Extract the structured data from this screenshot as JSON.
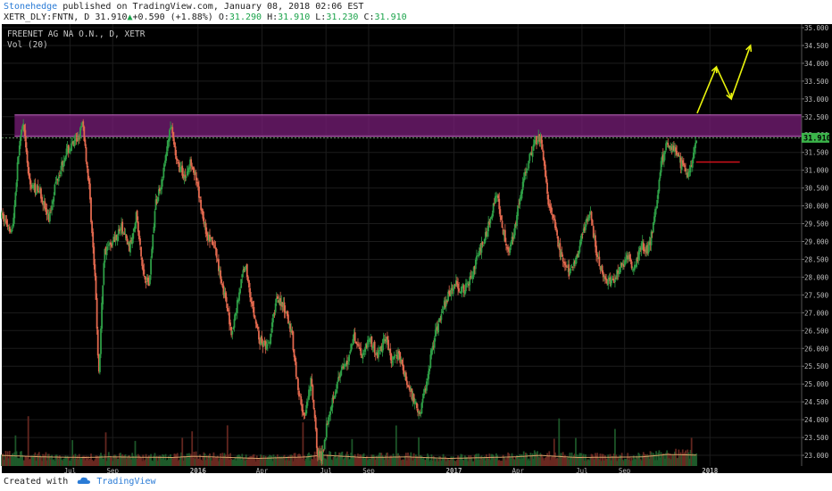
{
  "header": {
    "author": "Stonehedge",
    "published": "published on TradingView.com, January 08, 2018 02:06 EST",
    "symbol": "XETR_DLY:FNTN, D",
    "last": "31.910",
    "up_arrow": "▲",
    "change": "+0.590 (+1.88%)",
    "o_label": "O:",
    "o_val": "31.290",
    "h_label": "H:",
    "h_val": "31.910",
    "l_label": "L:",
    "l_val": "31.230",
    "c_label": "C:",
    "c_val": "31.910"
  },
  "footer": {
    "created_with": "Created with",
    "tv_icon": "cloud-logo-icon",
    "brand": "TradingView"
  },
  "colors": {
    "background": "#000000",
    "grid": "#1c1c1c",
    "up": "#2e9e46",
    "down": "#e1684e",
    "zone": "#7d1f7d",
    "zone_border": "#c66ac6",
    "annotation": "#e8f20d",
    "support": "#d1111b",
    "last_price_label": "#3bb54a",
    "vol_ma": "#d9a36a"
  },
  "chart_data": {
    "type": "candlestick",
    "title": "FREENET AG NA O.N., D, XETR",
    "volume_label": "Vol (20)",
    "last_price_label": "31.910",
    "ylim": [
      22.7,
      35.1
    ],
    "y_ticks": [
      "35.000",
      "34.500",
      "34.000",
      "33.500",
      "33.000",
      "32.500",
      "32.000",
      "31.500",
      "31.000",
      "30.500",
      "30.000",
      "29.500",
      "29.000",
      "28.500",
      "28.000",
      "27.500",
      "27.000",
      "26.500",
      "26.000",
      "25.500",
      "25.000",
      "24.500",
      "24.000",
      "23.500",
      "23.000"
    ],
    "x_ticks": [
      "Jul",
      "Sep",
      "2016",
      "Apr",
      "Jul",
      "Sep",
      "2017",
      "Apr",
      "Jul",
      "Sep",
      "2018"
    ],
    "x_tick_month_index": [
      3.2,
      5.2,
      9.2,
      12.2,
      15.2,
      17.2,
      21.2,
      24.2,
      27.2,
      29.2,
      33.2
    ],
    "x_range_months": [
      0.0,
      37.5
    ],
    "price_path": [
      [
        0.0,
        29.7
      ],
      [
        0.5,
        29.3
      ],
      [
        0.8,
        31.6
      ],
      [
        1.0,
        32.3
      ],
      [
        1.3,
        30.6
      ],
      [
        1.8,
        30.4
      ],
      [
        2.2,
        29.6
      ],
      [
        2.5,
        30.6
      ],
      [
        3.0,
        31.5
      ],
      [
        3.5,
        31.8
      ],
      [
        3.8,
        32.3
      ],
      [
        4.1,
        30.5
      ],
      [
        4.4,
        27.6
      ],
      [
        4.55,
        25.2
      ],
      [
        4.8,
        28.7
      ],
      [
        5.2,
        29.0
      ],
      [
        5.6,
        29.4
      ],
      [
        6.0,
        28.8
      ],
      [
        6.3,
        29.8
      ],
      [
        6.6,
        28.2
      ],
      [
        6.9,
        27.8
      ],
      [
        7.2,
        30.0
      ],
      [
        7.6,
        31.0
      ],
      [
        7.9,
        32.3
      ],
      [
        8.2,
        31.2
      ],
      [
        8.6,
        30.8
      ],
      [
        8.9,
        31.3
      ],
      [
        9.2,
        30.4
      ],
      [
        9.6,
        29.2
      ],
      [
        10.0,
        28.8
      ],
      [
        10.4,
        27.6
      ],
      [
        10.8,
        26.4
      ],
      [
        11.1,
        27.5
      ],
      [
        11.4,
        28.4
      ],
      [
        11.8,
        27.0
      ],
      [
        12.1,
        26.2
      ],
      [
        12.5,
        26.0
      ],
      [
        12.9,
        27.5
      ],
      [
        13.3,
        27.0
      ],
      [
        13.6,
        26.4
      ],
      [
        13.9,
        24.8
      ],
      [
        14.2,
        24.0
      ],
      [
        14.5,
        25.1
      ],
      [
        14.8,
        23.1
      ],
      [
        15.0,
        22.9
      ],
      [
        15.3,
        24.1
      ],
      [
        15.6,
        24.8
      ],
      [
        15.9,
        25.3
      ],
      [
        16.2,
        25.6
      ],
      [
        16.5,
        26.4
      ],
      [
        16.9,
        25.8
      ],
      [
        17.2,
        26.3
      ],
      [
        17.6,
        25.8
      ],
      [
        18.0,
        26.3
      ],
      [
        18.3,
        25.6
      ],
      [
        18.6,
        25.9
      ],
      [
        19.0,
        25.0
      ],
      [
        19.3,
        24.6
      ],
      [
        19.6,
        24.2
      ],
      [
        19.9,
        25.0
      ],
      [
        20.2,
        26.1
      ],
      [
        20.6,
        27.0
      ],
      [
        21.0,
        27.6
      ],
      [
        21.3,
        27.8
      ],
      [
        21.7,
        27.6
      ],
      [
        22.1,
        28.2
      ],
      [
        22.4,
        28.7
      ],
      [
        22.8,
        29.4
      ],
      [
        23.2,
        30.4
      ],
      [
        23.5,
        29.3
      ],
      [
        23.8,
        28.7
      ],
      [
        24.1,
        29.6
      ],
      [
        24.5,
        30.8
      ],
      [
        24.8,
        31.5
      ],
      [
        25.1,
        31.9
      ],
      [
        25.3,
        31.8
      ],
      [
        25.6,
        30.2
      ],
      [
        25.9,
        29.5
      ],
      [
        26.2,
        28.6
      ],
      [
        26.6,
        28.1
      ],
      [
        26.9,
        28.4
      ],
      [
        27.2,
        29.3
      ],
      [
        27.6,
        29.7
      ],
      [
        27.9,
        28.6
      ],
      [
        28.2,
        28.0
      ],
      [
        28.6,
        27.8
      ],
      [
        28.9,
        28.2
      ],
      [
        29.3,
        28.5
      ],
      [
        29.7,
        28.3
      ],
      [
        30.0,
        28.9
      ],
      [
        30.3,
        28.7
      ],
      [
        30.6,
        29.6
      ],
      [
        30.9,
        31.2
      ],
      [
        31.2,
        31.8
      ],
      [
        31.6,
        31.5
      ],
      [
        31.9,
        31.1
      ],
      [
        32.2,
        30.9
      ],
      [
        32.4,
        31.3
      ],
      [
        32.6,
        31.9
      ]
    ],
    "volume_path": [
      [
        0.0,
        0.35
      ],
      [
        2.0,
        0.3
      ],
      [
        3.9,
        0.28
      ],
      [
        5.0,
        0.3
      ],
      [
        8.0,
        0.28
      ],
      [
        9.0,
        0.32
      ],
      [
        12.0,
        0.25
      ],
      [
        14.3,
        0.3
      ],
      [
        15.0,
        0.36
      ],
      [
        17.0,
        0.28
      ],
      [
        19.0,
        0.3
      ],
      [
        21.0,
        0.25
      ],
      [
        24.0,
        0.3
      ],
      [
        25.2,
        0.35
      ],
      [
        27.0,
        0.28
      ],
      [
        30.0,
        0.3
      ],
      [
        31.2,
        0.38
      ],
      [
        32.6,
        0.36
      ]
    ],
    "zone": {
      "low": 31.95,
      "high": 32.55,
      "x_start": 0.6,
      "x_end": 37.5
    },
    "support_line": {
      "price": 31.23,
      "x_start": 32.55,
      "x_end": 34.6
    },
    "projection_path": [
      [
        32.6,
        32.6
      ],
      [
        33.5,
        33.9
      ],
      [
        34.2,
        33.0
      ],
      [
        35.1,
        34.5
      ]
    ]
  }
}
